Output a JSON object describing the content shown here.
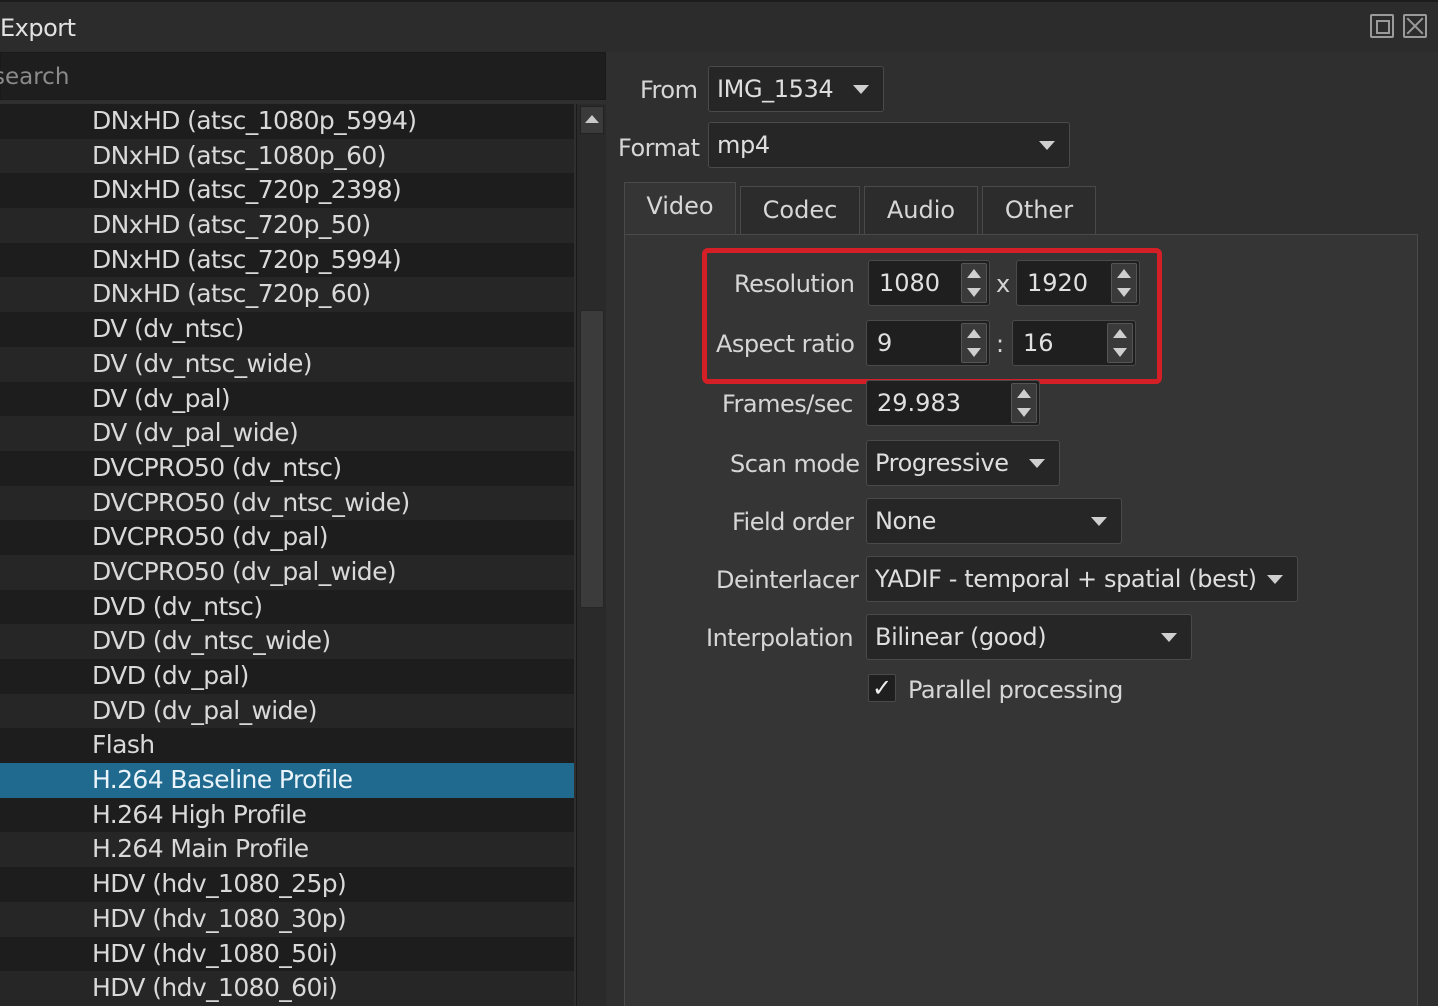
{
  "window": {
    "title": "Export"
  },
  "icons": {
    "float": "float-window-icon",
    "close": "close-icon",
    "up": "scroll-up-arrow-icon",
    "dropdown": "dropdown-arrow-icon",
    "check": "checkmark-icon"
  },
  "search": {
    "placeholder": "search"
  },
  "presets": [
    "DNxHD (atsc_1080p_5994)",
    "DNxHD (atsc_1080p_60)",
    "DNxHD (atsc_720p_2398)",
    "DNxHD (atsc_720p_50)",
    "DNxHD (atsc_720p_5994)",
    "DNxHD (atsc_720p_60)",
    "DV (dv_ntsc)",
    "DV (dv_ntsc_wide)",
    "DV (dv_pal)",
    "DV (dv_pal_wide)",
    "DVCPRO50 (dv_ntsc)",
    "DVCPRO50 (dv_ntsc_wide)",
    "DVCPRO50 (dv_pal)",
    "DVCPRO50 (dv_pal_wide)",
    "DVD (dv_ntsc)",
    "DVD (dv_ntsc_wide)",
    "DVD (dv_pal)",
    "DVD (dv_pal_wide)",
    "Flash",
    "H.264 Baseline Profile",
    "H.264 High Profile",
    "H.264 Main Profile",
    "HDV (hdv_1080_25p)",
    "HDV (hdv_1080_30p)",
    "HDV (hdv_1080_50i)",
    "HDV (hdv_1080_60i)"
  ],
  "selected_preset": "H.264 Baseline Profile",
  "from": {
    "label": "From",
    "value": "IMG_1534"
  },
  "format": {
    "label": "Format",
    "value": "mp4"
  },
  "tabs": [
    "Video",
    "Codec",
    "Audio",
    "Other"
  ],
  "active_tab": "Video",
  "video": {
    "resolution": {
      "label": "Resolution",
      "width": "1080",
      "sep": "x",
      "height": "1920"
    },
    "aspect": {
      "label": "Aspect ratio",
      "num": "9",
      "sep": ":",
      "den": "16"
    },
    "fps": {
      "label": "Frames/sec",
      "value": "29.983"
    },
    "scan_mode": {
      "label": "Scan mode",
      "value": "Progressive"
    },
    "field_order": {
      "label": "Field order",
      "value": "None"
    },
    "deinterlacer": {
      "label": "Deinterlacer",
      "value": "YADIF - temporal + spatial (best)"
    },
    "interpolation": {
      "label": "Interpolation",
      "value": "Bilinear (good)"
    },
    "parallel": {
      "label": "Parallel processing",
      "checked": true,
      "mark": "✓"
    }
  },
  "colors": {
    "selection": "#1f6a8e",
    "highlight": "#d41f26"
  }
}
